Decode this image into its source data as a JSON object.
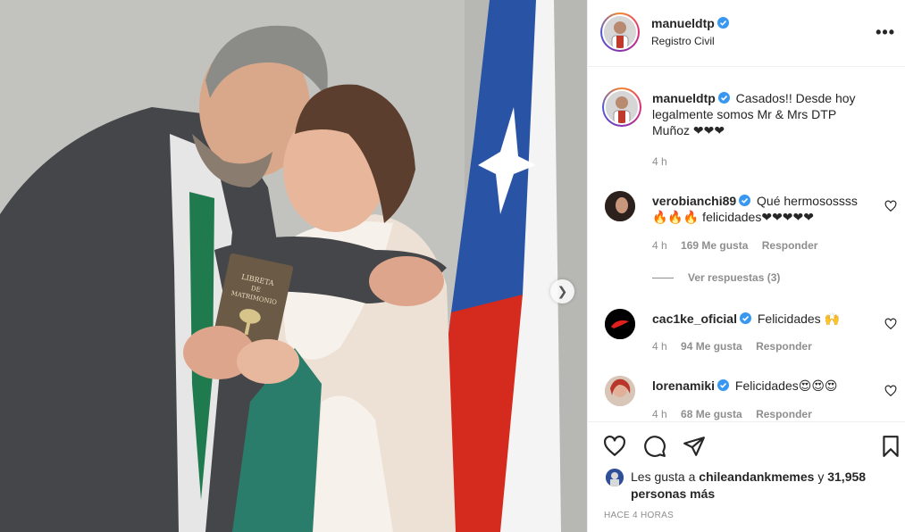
{
  "post": {
    "username": "manueldtp",
    "location": "Registro Civil",
    "caption": {
      "username": "manueldtp",
      "text": "Casados!! Desde hoy legalmente somos Mr & Mrs DTP Muñoz ❤❤❤",
      "time": "4 h"
    }
  },
  "comments": [
    {
      "username": "verobianchi89",
      "text": "Qué hermosossss 🔥🔥🔥 felicidades❤❤❤❤❤",
      "time": "4 h",
      "likes": "169 Me gusta",
      "reply": "Responder"
    },
    {
      "username": "cac1ke_oficial",
      "text": "Felicidades 🙌",
      "time": "4 h",
      "likes": "94 Me gusta",
      "reply": "Responder"
    },
    {
      "username": "lorenamiki",
      "text": "Felicidades😍😍😍",
      "time": "4 h",
      "likes": "68 Me gusta",
      "reply": "Responder"
    }
  ],
  "view_replies": "Ver respuestas (3)",
  "likes": {
    "prefix": "Les gusta a",
    "user": "chileandankmemes",
    "connector": "y",
    "others": "31,958 personas más"
  },
  "time_ago": "HACE 4 HORAS",
  "icons": [
    "heart-icon",
    "comment-icon",
    "share-icon",
    "bookmark-icon",
    "more-icon",
    "verified-icon",
    "chevron-right-icon"
  ],
  "colors": {
    "verified": "#3897f0",
    "muted": "#8e8e8e",
    "text": "#262626"
  }
}
